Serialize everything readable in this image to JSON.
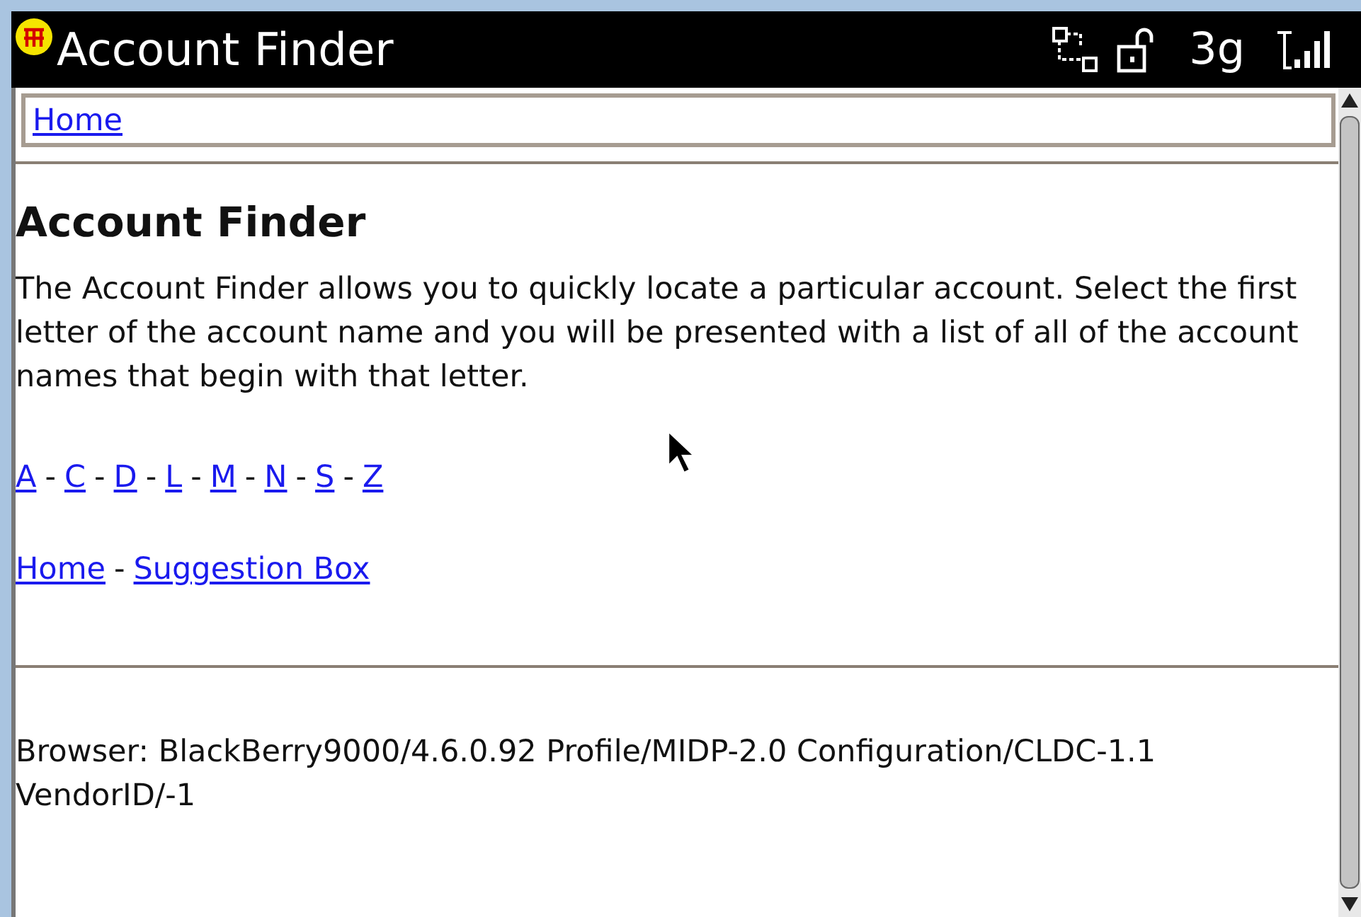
{
  "status_bar": {
    "title": "Account Finder",
    "network": "3g"
  },
  "breadcrumb": {
    "link": "Home"
  },
  "page": {
    "heading": "Account Finder",
    "description": "The Account Finder allows you to quickly locate a particular account. Select the first letter of the account name and you will be presented with a list of all of the account names that begin with that letter.",
    "letters": [
      "A",
      "C",
      "D",
      "L",
      "M",
      "N",
      "S",
      "Z"
    ],
    "separator": "-",
    "footer_links": [
      "Home",
      "Suggestion Box"
    ]
  },
  "browser_info": "Browser: BlackBerry9000/4.6.0.92 Profile/MIDP-2.0 Configuration/CLDC-1.1 VendorID/-1"
}
